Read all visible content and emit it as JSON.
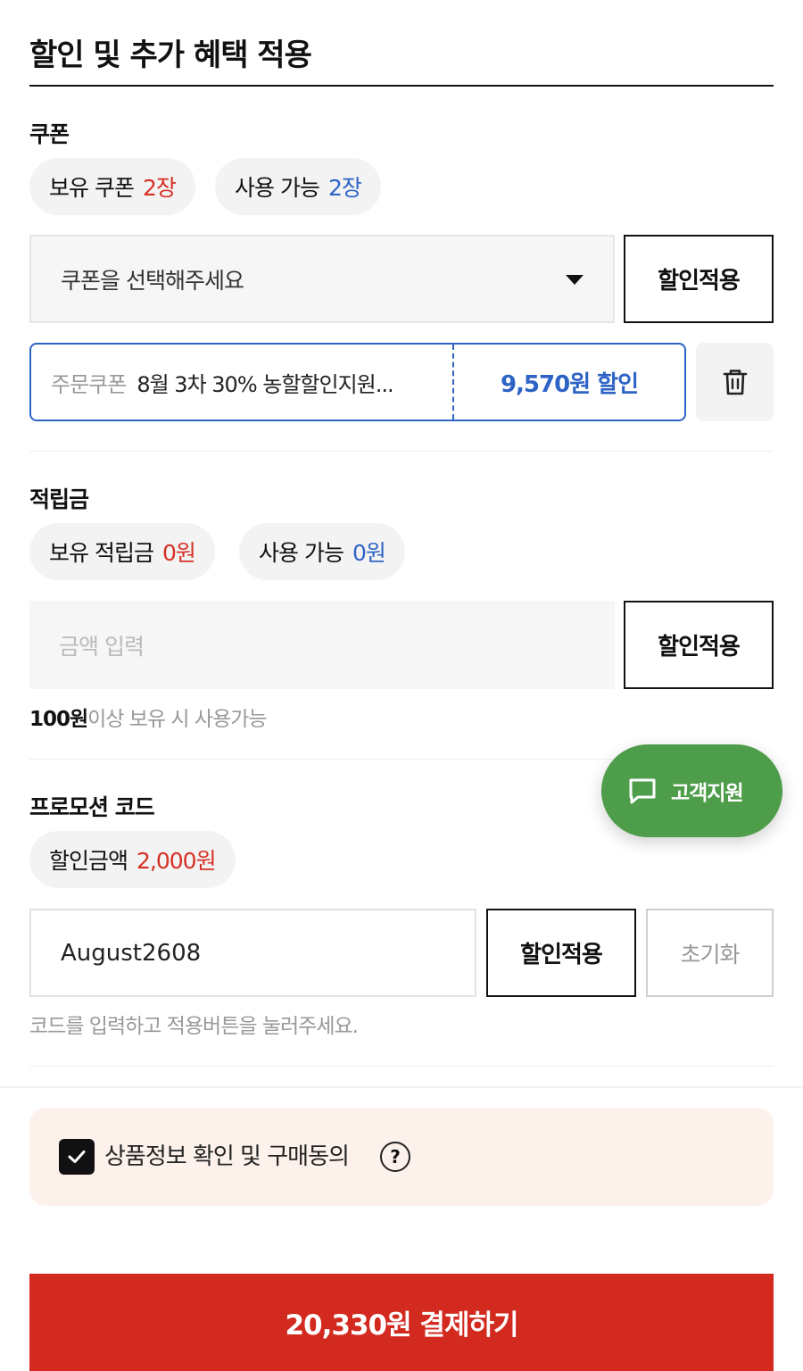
{
  "page": {
    "title": "할인 및 추가 혜택 적용"
  },
  "coupon": {
    "section_label": "쿠폰",
    "owned_label": "보유 쿠폰",
    "owned_count": "2장",
    "usable_label": "사용 가능",
    "usable_count": "2장",
    "select_placeholder": "쿠폰을 선택해주세요",
    "apply_label": "할인적용",
    "applied": {
      "tag": "주문쿠폰",
      "name": "8월 3차 30% 농할할인지원...",
      "discount": "9,570원 할인"
    }
  },
  "points": {
    "section_label": "적립금",
    "owned_label": "보유 적립금",
    "owned_amount": "0원",
    "usable_label": "사용 가능",
    "usable_amount": "0원",
    "input_placeholder": "금액 입력",
    "apply_label": "할인적용",
    "hint_bold": "100원",
    "hint_rest": "이상 보유 시 사용가능"
  },
  "promo": {
    "section_label": "프로모션 코드",
    "discount_label": "할인금액",
    "discount_amount": "2,000원",
    "code_value": "August2608",
    "apply_label": "할인적용",
    "reset_label": "초기화",
    "hint": "코드를 입력하고 적용버튼을 눌러주세요."
  },
  "support": {
    "label": "고객지원"
  },
  "agreement": {
    "label": "상품정보 확인 및 구매동의",
    "checked": true,
    "help_symbol": "?"
  },
  "payment": {
    "button_label": "20,330원 결제하기"
  },
  "colors": {
    "accent_red": "#d32a20",
    "accent_blue": "#2e63c6",
    "support_green": "#4e9d4a"
  },
  "icons": [
    "chevron-down-icon",
    "trash-icon",
    "chat-bubble-icon",
    "checkmark-icon",
    "help-icon"
  ]
}
